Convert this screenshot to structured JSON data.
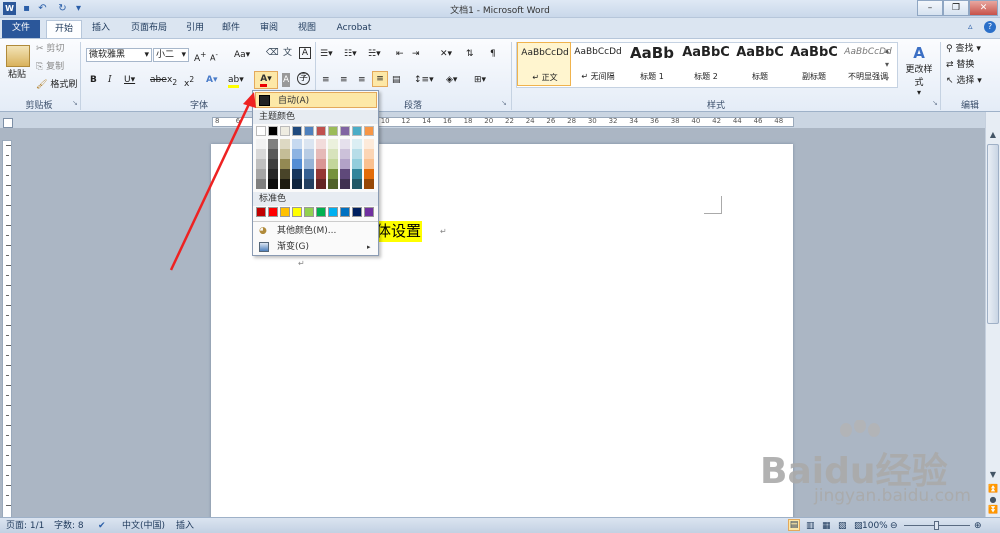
{
  "title": "文档1 - Microsoft Word",
  "tabs": {
    "file": "文件",
    "home": "开始",
    "insert": "插入",
    "layout": "页面布局",
    "references": "引用",
    "mailings": "邮件",
    "review": "审阅",
    "view": "视图",
    "acrobat": "Acrobat"
  },
  "clipboard": {
    "paste": "粘贴",
    "cut": "剪切",
    "copy": "复制",
    "format_painter": "格式刷",
    "group": "剪贴板"
  },
  "font": {
    "name": "微软雅黑",
    "size": "小二",
    "group": "字体"
  },
  "paragraph": {
    "group": "段落"
  },
  "styles": {
    "group": "样式",
    "items": [
      {
        "sample": "AaBbCcDd",
        "name": "↵ 正文"
      },
      {
        "sample": "AaBbCcDd",
        "name": "↵ 无间隔"
      },
      {
        "sample": "AaBb",
        "name": "标题 1"
      },
      {
        "sample": "AaBbC",
        "name": "标题 2"
      },
      {
        "sample": "AaBbC",
        "name": "标题"
      },
      {
        "sample": "AaBbC",
        "name": "副标题"
      },
      {
        "sample": "AaBbCcDd",
        "name": "不明显强调"
      }
    ],
    "change": "更改样式"
  },
  "editing": {
    "find": "查找",
    "replace": "替换",
    "select": "选择",
    "group": "编辑"
  },
  "font_color_menu": {
    "automatic": "自动(A)",
    "theme_colors": "主题颜色",
    "standard_colors": "标准色",
    "more_colors": "其他颜色(M)...",
    "gradient": "渐变(G)",
    "theme_top": [
      "#ffffff",
      "#000000",
      "#eeece1",
      "#1f497d",
      "#4f81bd",
      "#c0504d",
      "#9bbb59",
      "#8064a2",
      "#4bacc6",
      "#f79646"
    ],
    "theme_shades": [
      [
        "#f2f2f2",
        "#7f7f7f",
        "#ddd9c3",
        "#c6d9f0",
        "#dbe5f1",
        "#f2dcdb",
        "#ebf1dd",
        "#e5e0ec",
        "#dbeef3",
        "#fdeada"
      ],
      [
        "#d8d8d8",
        "#595959",
        "#c4bd97",
        "#8db3e2",
        "#b8cce4",
        "#e5b9b7",
        "#d7e3bc",
        "#ccc1d9",
        "#b7dde8",
        "#fbd5b5"
      ],
      [
        "#bfbfbf",
        "#3f3f3f",
        "#938953",
        "#548dd4",
        "#95b3d7",
        "#d99694",
        "#c3d69b",
        "#b2a2c7",
        "#92cddc",
        "#fac08f"
      ],
      [
        "#a5a5a5",
        "#262626",
        "#494429",
        "#17365d",
        "#366092",
        "#953734",
        "#76923c",
        "#5f497a",
        "#31859b",
        "#e36c09"
      ],
      [
        "#7f7f7f",
        "#0c0c0c",
        "#1d1b10",
        "#0f243e",
        "#244061",
        "#632423",
        "#4f6128",
        "#3f3151",
        "#205867",
        "#974806"
      ]
    ],
    "standard": [
      "#c00000",
      "#ff0000",
      "#ffc000",
      "#ffff00",
      "#92d050",
      "#00b050",
      "#00b0f0",
      "#0070c0",
      "#002060",
      "#7030a0"
    ]
  },
  "document": {
    "text": "百度经验字体设置"
  },
  "ruler": {
    "marks": [
      "8",
      "6",
      "4",
      "2",
      "2",
      "4",
      "6",
      "8",
      "10",
      "12",
      "14",
      "16",
      "18",
      "20",
      "22",
      "24",
      "26",
      "28",
      "30",
      "32",
      "34",
      "36",
      "38",
      "40",
      "42",
      "44",
      "46",
      "48"
    ]
  },
  "status": {
    "page": "页面: 1/1",
    "words": "字数: 8",
    "language": "中文(中国)",
    "mode": "插入",
    "zoom": "100%"
  },
  "watermark": {
    "brand": "Baidu经验",
    "url": "jingyan.baidu.com"
  },
  "colors": {
    "accent": "#2b579a",
    "highlight": "#ffff00",
    "arrow": "#ee2222"
  }
}
